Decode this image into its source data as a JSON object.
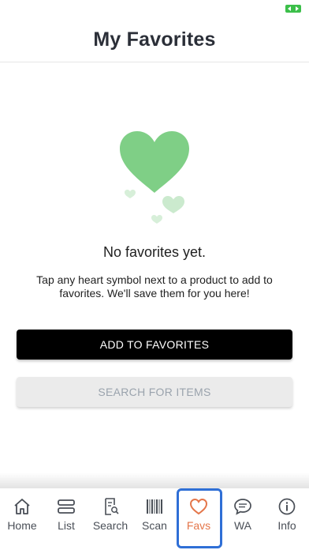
{
  "header": {
    "title": "My Favorites"
  },
  "empty_state": {
    "title": "No favorites yet.",
    "description": "Tap any heart symbol next to a product to add to favorites. We'll save them for you here!",
    "illustration": "heart-icon"
  },
  "buttons": {
    "add_favorites": "ADD TO FAVORITES",
    "search_items": "SEARCH FOR ITEMS"
  },
  "tabs": [
    {
      "label": "Home",
      "icon": "home-icon"
    },
    {
      "label": "List",
      "icon": "list-icon"
    },
    {
      "label": "Search",
      "icon": "search-doc-icon"
    },
    {
      "label": "Scan",
      "icon": "barcode-icon"
    },
    {
      "label": "Favs",
      "icon": "heart-icon",
      "active": true
    },
    {
      "label": "WA",
      "icon": "chat-icon"
    },
    {
      "label": "Info",
      "icon": "info-icon"
    }
  ],
  "colors": {
    "heart_green": "#7fcf86",
    "active_tab": "#e4764a",
    "selection_border": "#2f6fd6",
    "battery": "#3cbf4a"
  }
}
